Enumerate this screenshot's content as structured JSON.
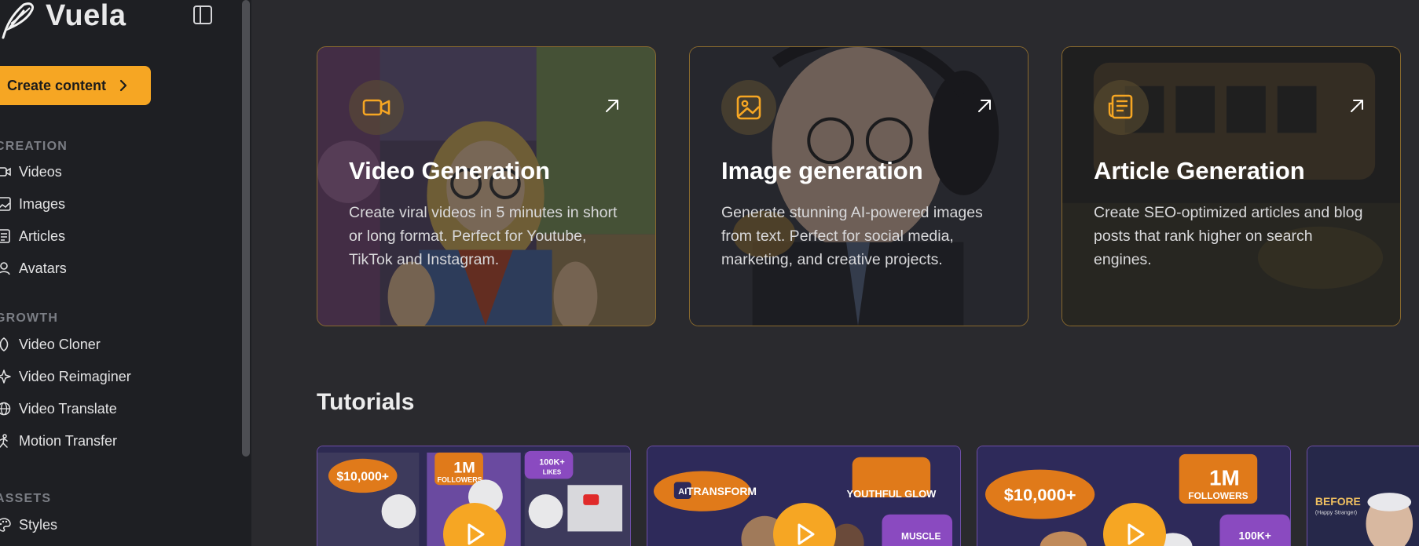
{
  "brand": {
    "name": "Vuela"
  },
  "sidebar": {
    "create_label": "Create content",
    "sections": [
      {
        "title": "CREATION",
        "items": [
          "Videos",
          "Images",
          "Articles",
          "Avatars"
        ]
      },
      {
        "title": "GROWTH",
        "items": [
          "Video Cloner",
          "Video Reimaginer",
          "Video Translate",
          "Motion Transfer"
        ]
      },
      {
        "title": "ASSETS",
        "items": [
          "Styles"
        ]
      }
    ]
  },
  "cards": [
    {
      "title": "Video Generation",
      "description": "Create viral videos in 5 minutes in short or long format. Perfect for Youtube, TikTok and Instagram.",
      "icon": "video-camera-icon"
    },
    {
      "title": "Image generation",
      "description": "Generate stunning AI-powered images from text. Perfect for social media, marketing, and creative projects.",
      "icon": "image-icon"
    },
    {
      "title": "Article Generation",
      "description": "Create SEO-optimized articles and blog posts that rank higher on search engines.",
      "icon": "article-icon"
    }
  ],
  "tutorials": {
    "title": "Tutorials",
    "thumbnails": [
      {
        "texts": [
          "$10,000+",
          "1M",
          "FOLLOWERS",
          "100K+",
          "LIKES"
        ]
      },
      {
        "texts": [
          "AI",
          "TRANSFORM",
          "YOUTHFUL GLOW",
          "MUSCLE"
        ]
      },
      {
        "texts": [
          "$10,000+",
          "1M",
          "FOLLOWERS",
          "100K+"
        ]
      },
      {
        "texts": [
          "BEFORE",
          "(Happy Stranger)"
        ]
      }
    ]
  },
  "colors": {
    "accent": "#f6a623",
    "sidebar_bg": "#1e1f23",
    "main_bg": "#2a2a2e",
    "card_border": "#8a6a2e"
  }
}
